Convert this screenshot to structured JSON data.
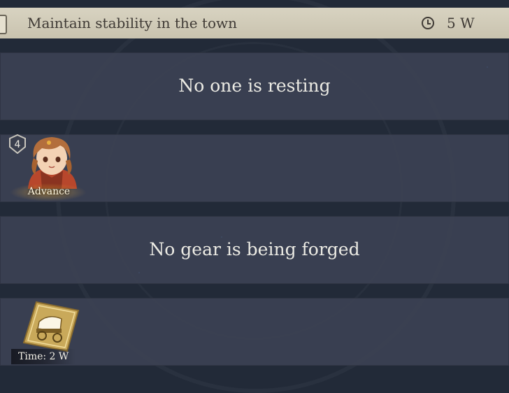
{
  "header": {
    "title": "Maintain stability in the town",
    "time_icon": "clock-icon",
    "time_value": "5 W"
  },
  "rest_panel": {
    "empty_text": "No one is resting"
  },
  "character_panel": {
    "level": "4",
    "character_icon": "character-portrait",
    "action_label": "Advance"
  },
  "forge_panel": {
    "empty_text": "No gear is being forged"
  },
  "wagon_panel": {
    "icon": "wagon-card-icon",
    "time_label": "Time:",
    "time_value": "2 W"
  },
  "colors": {
    "panel": "#3c4254",
    "background": "#222a38",
    "header": "#d2ccb9",
    "accent_glow": "#e6aa3c"
  }
}
